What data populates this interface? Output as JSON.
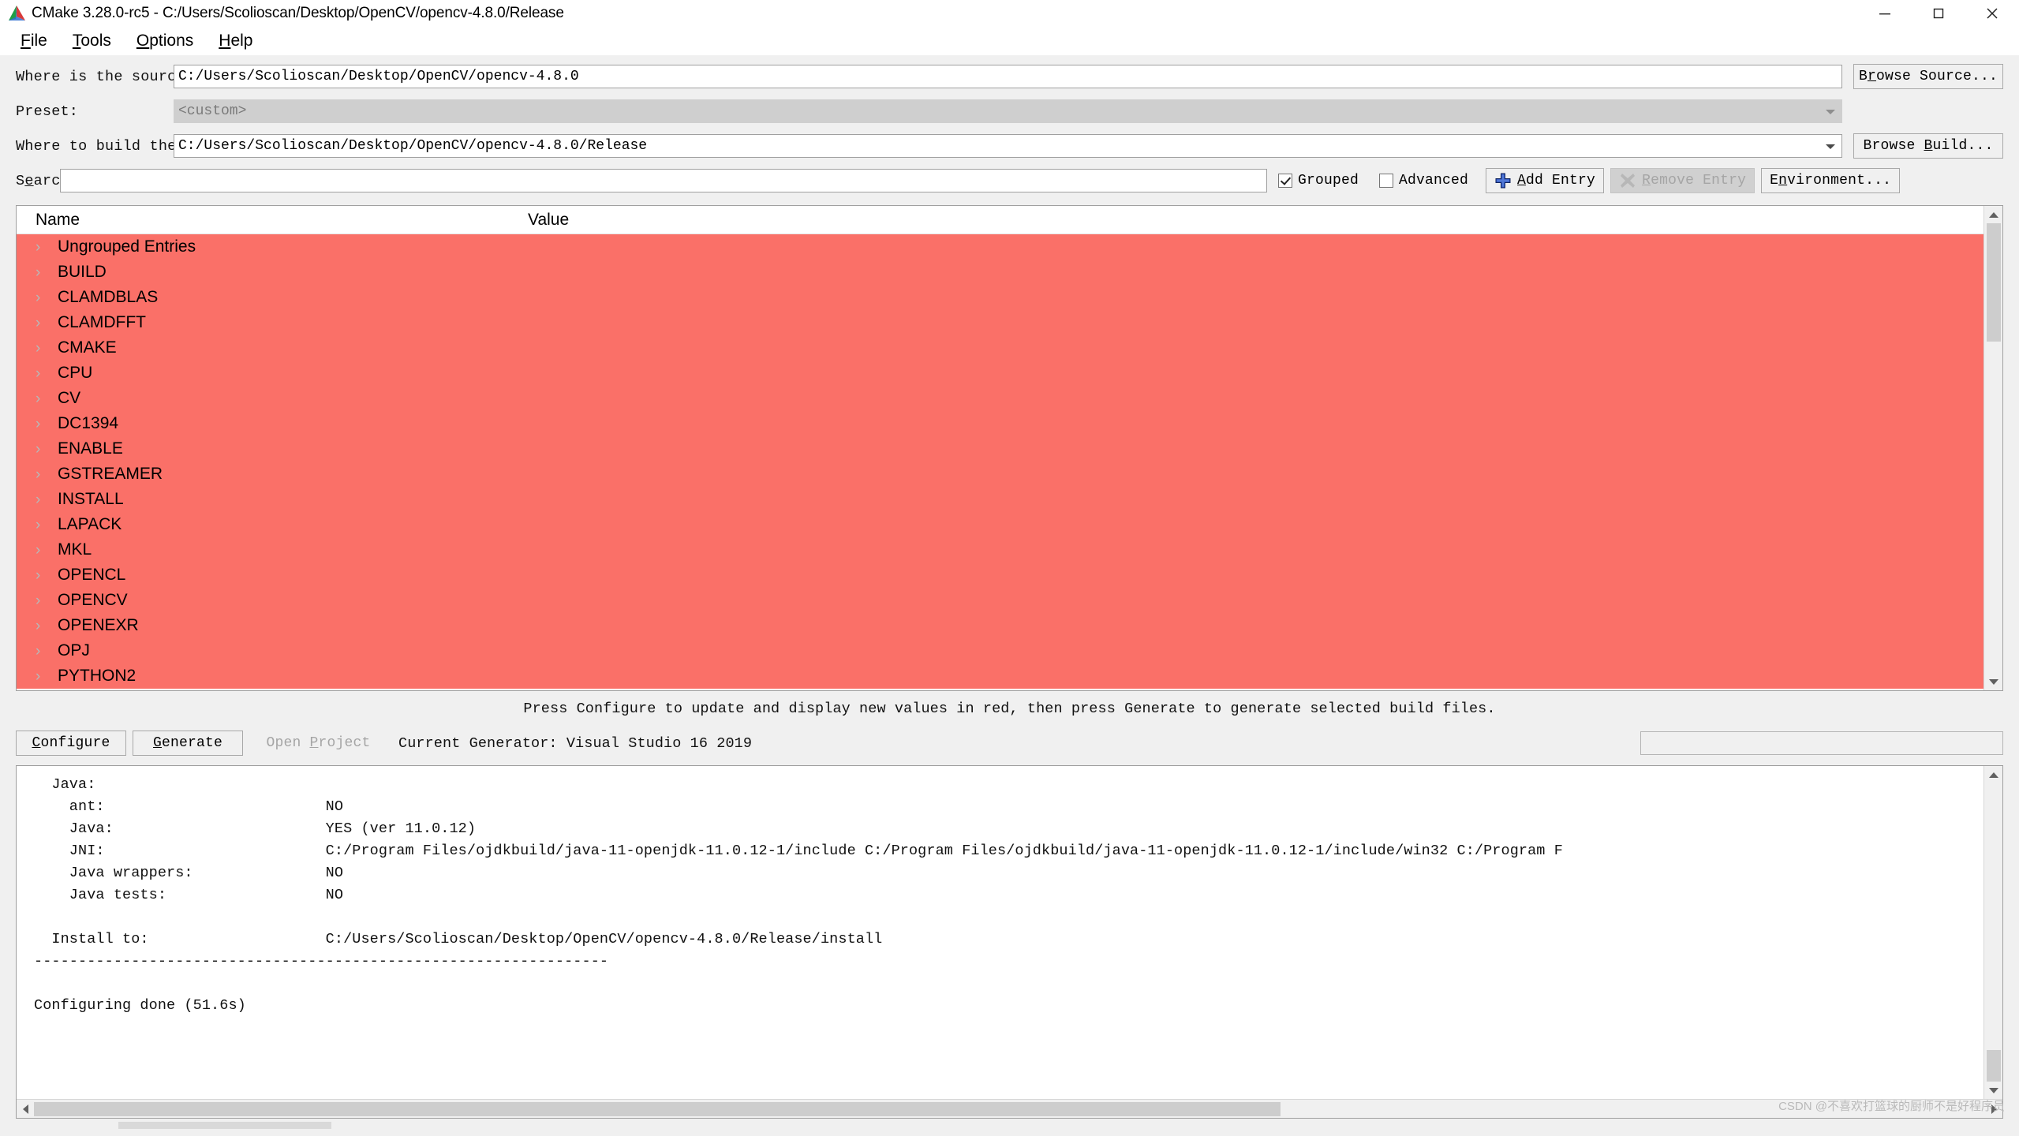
{
  "window": {
    "title": "CMake 3.28.0-rc5 - C:/Users/Scolioscan/Desktop/OpenCV/opencv-4.8.0/Release",
    "app_icon": "cmake-logo-icon",
    "minimize": "minimize-icon",
    "maximize": "maximize-icon",
    "close": "close-icon"
  },
  "menubar": {
    "items": [
      {
        "label": "File",
        "mnemonic": "F"
      },
      {
        "label": "Tools",
        "mnemonic": "T"
      },
      {
        "label": "Options",
        "mnemonic": "O"
      },
      {
        "label": "Help",
        "mnemonic": "H"
      }
    ]
  },
  "form": {
    "source_label": "Where is the source code:",
    "source_value": "C:/Users/Scolioscan/Desktop/OpenCV/opencv-4.8.0",
    "browse_source_label": "Browse Source...",
    "browse_source_mnemonic": "S",
    "preset_label": "Preset:",
    "preset_value": "<custom>",
    "preset_disabled": true,
    "binaries_label": "Where to build the binaries:",
    "binaries_value": "C:/Users/Scolioscan/Desktop/OpenCV/opencv-4.8.0/Release",
    "browse_build_label": "Browse Build...",
    "browse_build_mnemonic": "B",
    "search_label": "Search:",
    "search_mnemonic": "e",
    "search_value": "",
    "search_placeholder": ""
  },
  "toolbar": {
    "grouped_label": "Grouped",
    "grouped_checked": true,
    "advanced_label": "Advanced",
    "advanced_checked": false,
    "add_entry_label": "Add Entry",
    "add_entry_mnemonic": "A",
    "add_entry_icon": "plus-icon",
    "remove_entry_label": "Remove Entry",
    "remove_entry_mnemonic": "R",
    "remove_entry_icon": "x-mark-icon",
    "remove_entry_disabled": true,
    "environment_label": "Environment...",
    "environment_mnemonic": "n"
  },
  "cache": {
    "columns": [
      "Name",
      "Value"
    ],
    "highlight_color": "#fa7068",
    "rows": [
      {
        "name": "Ungrouped Entries",
        "value": "",
        "expandable": true
      },
      {
        "name": "BUILD",
        "value": "",
        "expandable": true
      },
      {
        "name": "CLAMDBLAS",
        "value": "",
        "expandable": true
      },
      {
        "name": "CLAMDFFT",
        "value": "",
        "expandable": true
      },
      {
        "name": "CMAKE",
        "value": "",
        "expandable": true
      },
      {
        "name": "CPU",
        "value": "",
        "expandable": true
      },
      {
        "name": "CV",
        "value": "",
        "expandable": true
      },
      {
        "name": "DC1394",
        "value": "",
        "expandable": true
      },
      {
        "name": "ENABLE",
        "value": "",
        "expandable": true
      },
      {
        "name": "GSTREAMER",
        "value": "",
        "expandable": true
      },
      {
        "name": "INSTALL",
        "value": "",
        "expandable": true
      },
      {
        "name": "LAPACK",
        "value": "",
        "expandable": true
      },
      {
        "name": "MKL",
        "value": "",
        "expandable": true
      },
      {
        "name": "OPENCL",
        "value": "",
        "expandable": true
      },
      {
        "name": "OPENCV",
        "value": "",
        "expandable": true
      },
      {
        "name": "OPENEXR",
        "value": "",
        "expandable": true
      },
      {
        "name": "OPJ",
        "value": "",
        "expandable": true
      },
      {
        "name": "PYTHON2",
        "value": "",
        "expandable": true
      }
    ]
  },
  "hint": "Press Configure to update and display new values in red, then press Generate to generate selected build files.",
  "actions": {
    "configure_label": "Configure",
    "configure_mnemonic": "C",
    "generate_label": "Generate",
    "generate_mnemonic": "G",
    "open_project_label": "Open Project",
    "open_project_mnemonic": "P",
    "open_project_disabled": true,
    "generator_text": "Current Generator: Visual Studio 16 2019"
  },
  "output": {
    "text": "  Java:\n    ant:                         NO\n    Java:                        YES (ver 11.0.12)\n    JNI:                         C:/Program Files/ojdkbuild/java-11-openjdk-11.0.12-1/include C:/Program Files/ojdkbuild/java-11-openjdk-11.0.12-1/include/win32 C:/Program F\n    Java wrappers:               NO\n    Java tests:                  NO\n\n  Install to:                    C:/Users/Scolioscan/Desktop/OpenCV/opencv-4.8.0/Release/install\n-----------------------------------------------------------------\n\nConfiguring done (51.6s)"
  },
  "watermark": "CSDN @不喜欢打篮球的厨师不是好程序员"
}
